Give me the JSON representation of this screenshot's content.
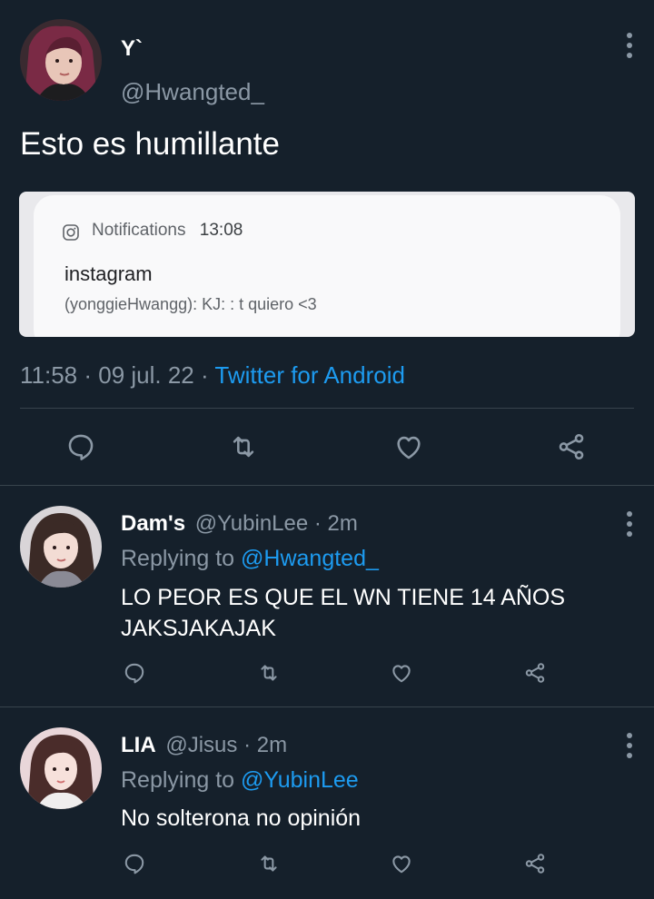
{
  "colors": {
    "background": "#15202b",
    "text_primary": "#ffffff",
    "text_secondary": "#8b98a5",
    "link": "#1d9bf0",
    "divider": "#38444d"
  },
  "main_tweet": {
    "author_name": "Y`",
    "author_handle": "@Hwangted_",
    "text": "Esto es humillante",
    "attached_image": {
      "notification_app_label": "Notifications",
      "notification_time": "13:08",
      "notification_title": "instagram",
      "notification_body": "(yonggieHwangg): KJ: : t quiero <3"
    },
    "timestamp": "11:58 · 09 jul. 22 · ",
    "source": "Twitter for Android",
    "actions": [
      "reply-icon",
      "retweet-icon",
      "like-icon",
      "share-icon"
    ]
  },
  "replies": [
    {
      "author_name": "Dam's",
      "author_handle": "@YubinLee",
      "age": "· 2m",
      "replying_label": "Replying to ",
      "replying_to": "@Hwangted_",
      "text_line1": "LO PEOR ES QUE EL WN TIENE 14 AÑOS",
      "text_line2": "JAKSJAKAJAK",
      "actions": [
        "reply-icon",
        "retweet-icon",
        "like-icon",
        "share-icon"
      ]
    },
    {
      "author_name": "LIA",
      "author_handle": "@Jisus",
      "age": "· 2m",
      "replying_label": "Replying to ",
      "replying_to": "@YubinLee",
      "text_line1": "No solterona no opinión",
      "actions": [
        "reply-icon",
        "retweet-icon",
        "like-icon",
        "share-icon"
      ]
    }
  ]
}
